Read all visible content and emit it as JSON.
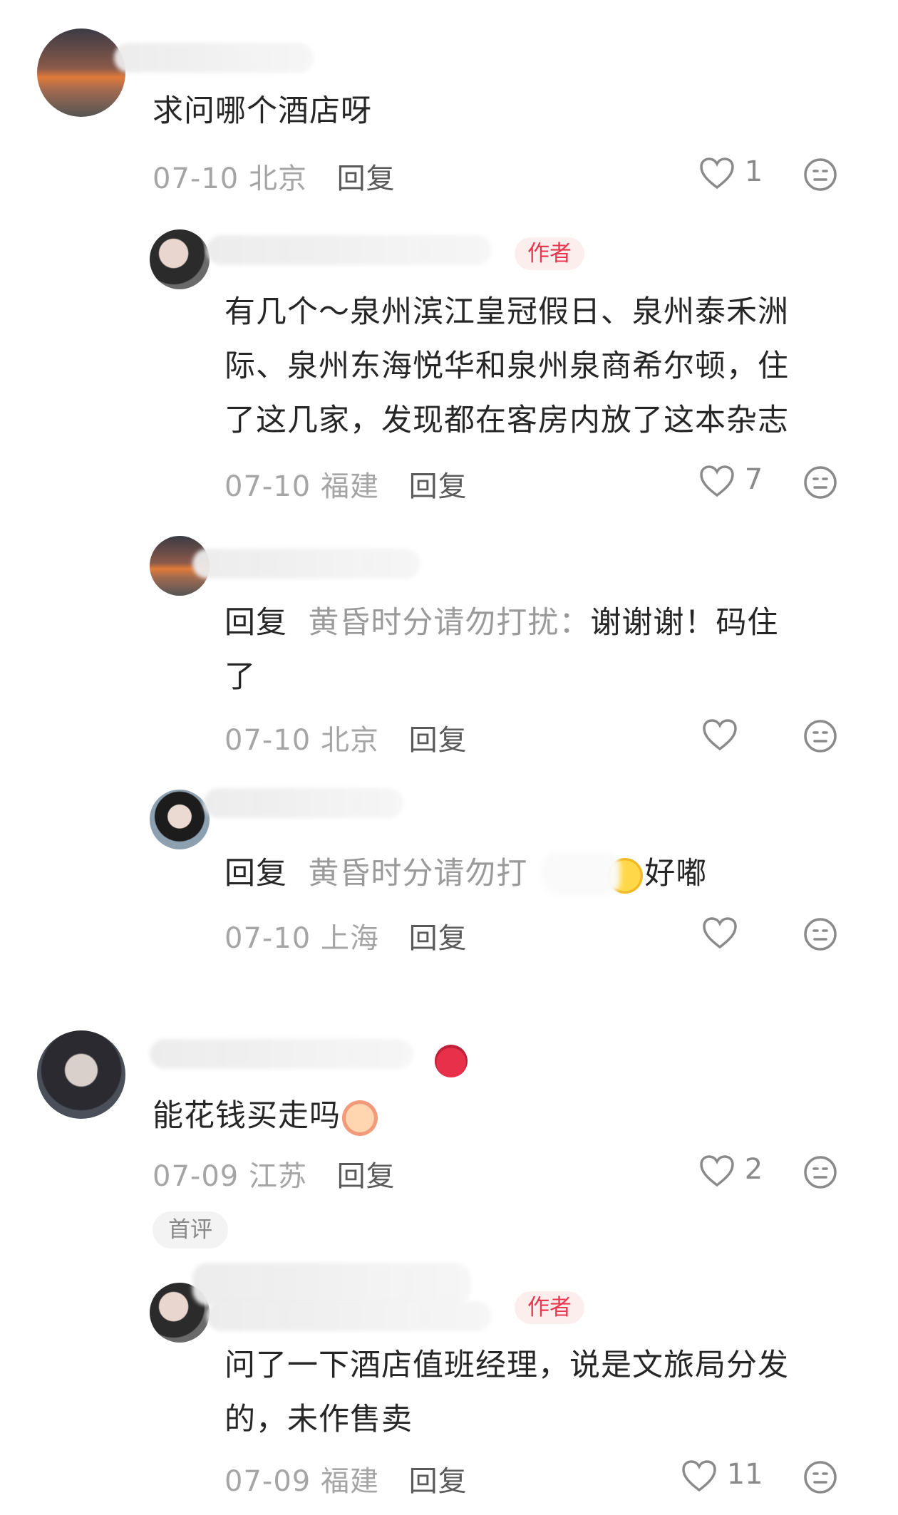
{
  "comments": [
    {
      "text": "求问哪个酒店呀",
      "date": "07-10",
      "location": "北京",
      "reply_label": "回复",
      "likes": "1"
    },
    {
      "badge": "作者",
      "text_line1": "有几个～泉州滨江皇冠假日、泉州泰禾洲",
      "text_line2": "际、泉州东海悦华和泉州泉商希尔顿，住",
      "text_line3": "了这几家，发现都在客房内放了这本杂志",
      "date": "07-10",
      "location": "福建",
      "reply_label": "回复",
      "likes": "7"
    },
    {
      "reply_prefix": "回复",
      "reply_to": "黄昏时分请勿打扰：",
      "text_line1": "谢谢谢！码住",
      "text_line2": "了",
      "date": "07-10",
      "location": "北京",
      "reply_label": "回复"
    },
    {
      "reply_prefix": "回复",
      "reply_to": "黄昏时分请勿打",
      "text": "好嘟",
      "date": "07-10",
      "location": "上海",
      "reply_label": "回复"
    },
    {
      "text": "能花钱买走吗",
      "date": "07-09",
      "location": "江苏",
      "reply_label": "回复",
      "likes": "2",
      "tag": "首评"
    },
    {
      "badge": "作者",
      "text_line1": "问了一下酒店值班经理，说是文旅局分发",
      "text_line2": "的，未作售卖",
      "date": "07-09",
      "location": "福建",
      "reply_label": "回复",
      "likes": "11"
    }
  ],
  "colors": {
    "badge_text": "#e8384f",
    "badge_bg": "#fdeeee",
    "meta": "#a5a5a5"
  }
}
